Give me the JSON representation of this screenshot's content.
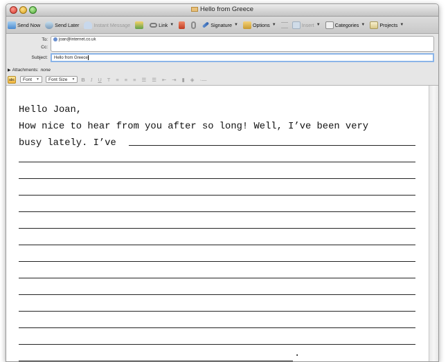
{
  "window": {
    "title": "Hello from Greece"
  },
  "toolbar": {
    "send_now": "Send Now",
    "send_later": "Send Later",
    "instant_message": "Instant Message",
    "link": "Link",
    "signature": "Signature",
    "options": "Options",
    "insert": "Insert",
    "categories": "Categories",
    "projects": "Projects"
  },
  "headers": {
    "to_label": "To:",
    "to_value": "joan@internet.co.uk",
    "cc_label": "Cc:",
    "cc_value": "",
    "subject_label": "Subject:",
    "subject_value": "Hello from Greece",
    "attachments_label": "Attachments:",
    "attachments_value": "none"
  },
  "format_bar": {
    "font": "Font",
    "font_size": "Font Size",
    "bold": "B",
    "italic": "I",
    "underline": "U",
    "text": "T"
  },
  "body": {
    "greeting": "Hello Joan,",
    "line1": "How nice to hear from you after so long! Well, I’ve been very",
    "line2": "busy lately. I’ve",
    "ending": "."
  },
  "colors": {
    "titlebar": "#d6d6d6",
    "toolbar": "#d0d0d0",
    "focus": "#8ab4e8"
  }
}
